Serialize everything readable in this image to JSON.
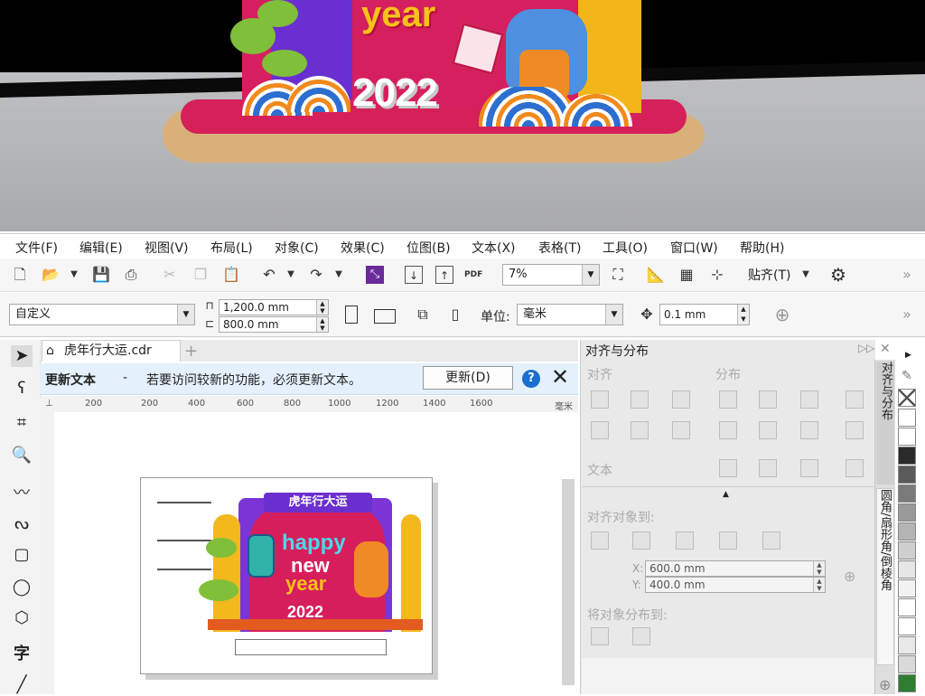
{
  "preview": {
    "year_text": "year",
    "number_text": "2022"
  },
  "menubar": {
    "items": [
      "文件(F)",
      "编辑(E)",
      "视图(V)",
      "布局(L)",
      "对象(C)",
      "效果(C)",
      "位图(B)",
      "文本(X)",
      "表格(T)",
      "工具(O)",
      "窗口(W)",
      "帮助(H)"
    ]
  },
  "toolbar": {
    "zoom_value": "7%",
    "snap_label": "贴齐(T)",
    "pdf_label": "PDF"
  },
  "propbar": {
    "preset": "自定义",
    "width": "1,200.0 mm",
    "height": "800.0 mm",
    "unit_label": "单位:",
    "unit_value": "毫米",
    "nudge_value": "0.1 mm"
  },
  "document": {
    "tab_title": "虎年行大运.cdr",
    "notice_title": "更新文本",
    "notice_dash": "-",
    "notice_text": "若要访问较新的功能，必须更新文本。",
    "update_button": "更新(D)",
    "ruler_marks": [
      "200",
      "200",
      "400",
      "600",
      "800",
      "1000",
      "1200",
      "1400",
      "1600"
    ],
    "ruler_unit": "毫米",
    "artwork_banner": "虎年行大运",
    "artwork_happy": "happy",
    "artwork_new": "new",
    "artwork_year": "year",
    "artwork_2022": "2022"
  },
  "docker": {
    "title": "对齐与分布",
    "section_align": "对齐",
    "section_distribute": "分布",
    "section_text": "文本",
    "section_align_to": "对齐对象到:",
    "x_label": "X:",
    "x_value": "600.0 mm",
    "y_label": "Y:",
    "y_value": "400.0 mm",
    "section_distribute_to": "将对象分布到:",
    "side_tab_1": "对齐与分布",
    "side_tab_2": "圆角/扇形角/倒棱角"
  },
  "palette": {
    "colors": [
      "#ffffff",
      "#ffffff",
      "#2b2b2b",
      "#5a5a5a",
      "#7a7a7a",
      "#9a9a9a",
      "#b4b4b4",
      "#cfcfcf",
      "#e6e6e6",
      "#f2f2f2",
      "#ffffff",
      "#ffffff",
      "#e8e8e8",
      "#d9d9d9",
      "#2e7d32"
    ]
  }
}
